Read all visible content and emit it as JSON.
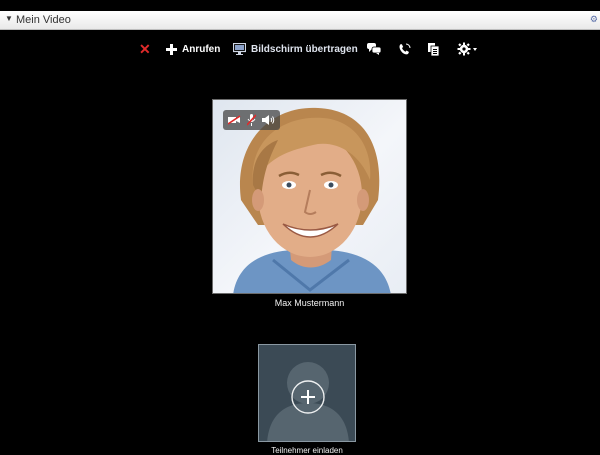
{
  "window": {
    "title": "Mein Video"
  },
  "toolbar": {
    "close_icon": "close-x-icon",
    "call_label": "Anrufen",
    "screen_share_label": "Bildschirm übertragen",
    "chat_icon": "chat-bubbles-icon",
    "phone_icon": "phone-icon",
    "files_icon": "files-icon",
    "settings_icon": "gear-dropdown-icon"
  },
  "video": {
    "participant_name": "Max Mustermann",
    "controls": [
      "camera-off-icon",
      "mic-off-icon",
      "speaker-icon"
    ]
  },
  "invite": {
    "label": "Teilnehmer einladen"
  },
  "colors": {
    "background": "#000000",
    "close_red": "#e02a2a",
    "invite_tile": "#3b4a55"
  }
}
